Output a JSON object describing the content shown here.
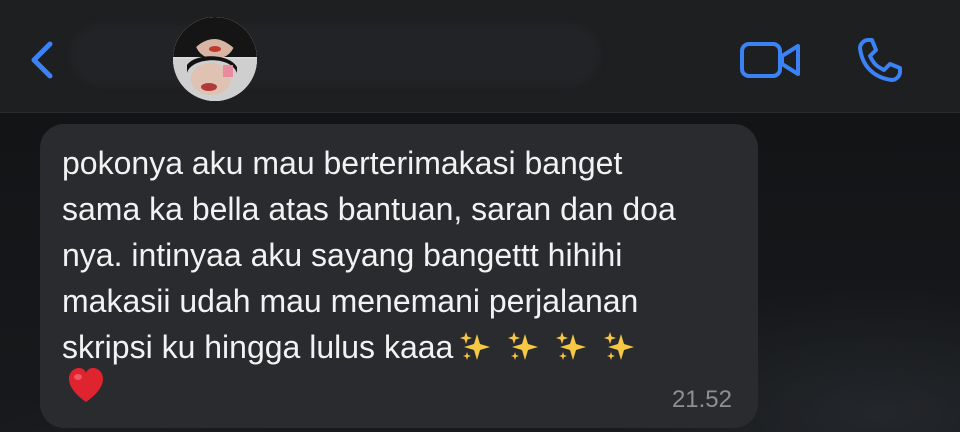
{
  "header": {
    "back_icon": "chevron-left-icon",
    "avatar_icon": "contact-avatar",
    "video_icon": "video-camera-icon",
    "phone_icon": "phone-icon",
    "accent_color": "#3b82f6"
  },
  "message": {
    "lines": [
      "pokonya aku mau berterimakasi banget",
      "sama ka bella atas bantuan, saran dan doa",
      "nya. intinyaa aku sayang bangettt hihihi",
      "makasii udah mau menemani perjalanan",
      "skripsi ku hingga lulus kaaa"
    ],
    "emojis": [
      "sparkles-icon",
      "sparkles-icon",
      "sparkles-icon",
      "sparkles-icon",
      "heart-icon"
    ],
    "timestamp": "21.52",
    "bubble_color": "#2a2b2e",
    "text_color": "#f2f2f2"
  }
}
